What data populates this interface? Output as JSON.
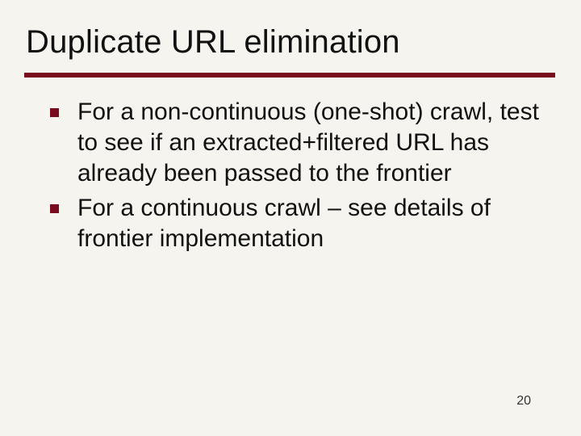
{
  "title": "Duplicate URL elimination",
  "bullets": [
    "For a non-continuous (one-shot) crawl, test to see if an extracted+filtered URL has already been passed to the frontier",
    "For a continuous crawl – see details of frontier implementation"
  ],
  "page_number": "20"
}
